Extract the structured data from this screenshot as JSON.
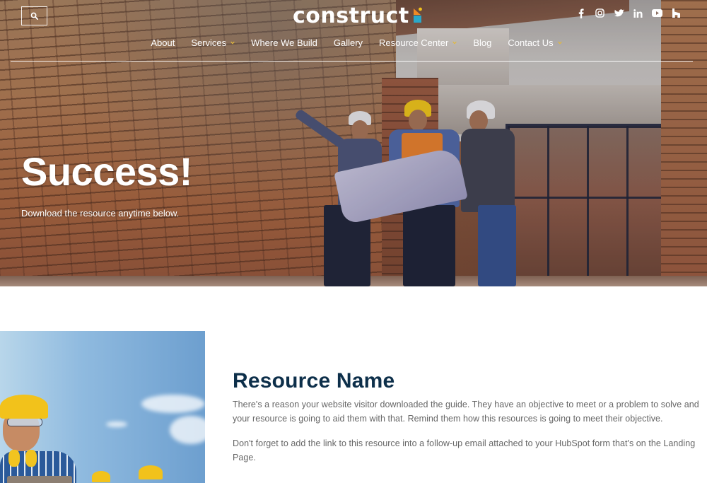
{
  "header": {
    "search_label": "Search",
    "logo_text": "construct",
    "brand_colors": {
      "logo_orange": "#f08a24",
      "logo_blue": "#2aa8c9",
      "logo_yellow": "#f2c21b",
      "nav_chevron": "#e3b93a",
      "heading_navy": "#0d2f4a"
    },
    "social": [
      {
        "name": "facebook",
        "icon": "facebook-icon"
      },
      {
        "name": "instagram",
        "icon": "instagram-icon"
      },
      {
        "name": "twitter",
        "icon": "twitter-icon"
      },
      {
        "name": "linkedin",
        "icon": "linkedin-icon"
      },
      {
        "name": "youtube",
        "icon": "youtube-icon"
      },
      {
        "name": "houzz",
        "icon": "houzz-icon"
      }
    ],
    "nav": [
      {
        "label": "About",
        "has_dropdown": false
      },
      {
        "label": "Services",
        "has_dropdown": true
      },
      {
        "label": "Where We Build",
        "has_dropdown": false
      },
      {
        "label": "Gallery",
        "has_dropdown": false
      },
      {
        "label": "Resource Center",
        "has_dropdown": true
      },
      {
        "label": "Blog",
        "has_dropdown": false
      },
      {
        "label": "Contact Us",
        "has_dropdown": true
      }
    ]
  },
  "hero": {
    "title": "Success!",
    "subtitle": "Download the resource anytime below."
  },
  "content": {
    "title": "Resource Name",
    "paragraphs": [
      "There's a reason your website visitor downloaded the guide. They have an objective to meet or a problem to solve and your resource is going to aid them with that. Remind them how this resources is going to meet their objective.",
      "Don't forget to add the link to this resource into a follow-up email attached to your HubSpot form that's on the Landing Page."
    ]
  }
}
